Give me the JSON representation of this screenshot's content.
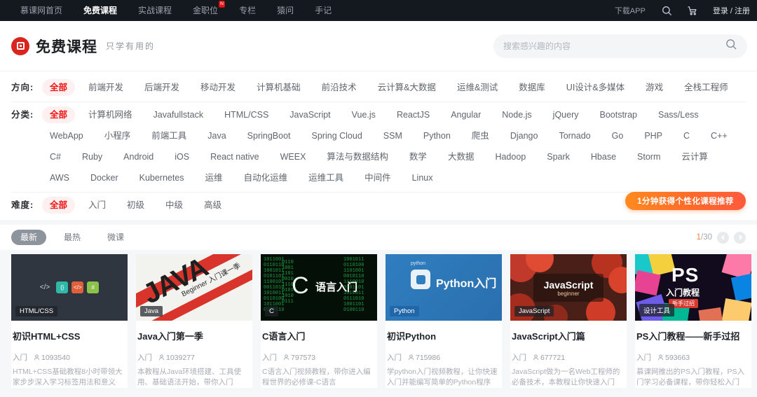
{
  "topnav": {
    "items": [
      {
        "label": "慕课网首页",
        "active": false,
        "badge": ""
      },
      {
        "label": "免费课程",
        "active": true,
        "badge": ""
      },
      {
        "label": "实战课程",
        "active": false,
        "badge": ""
      },
      {
        "label": "金职位",
        "active": false,
        "badge": "N"
      },
      {
        "label": "专栏",
        "active": false,
        "badge": ""
      },
      {
        "label": "猿问",
        "active": false,
        "badge": ""
      },
      {
        "label": "手记",
        "active": false,
        "badge": ""
      }
    ],
    "download_app": "下载APP",
    "search_icon": "search-icon",
    "cart_icon": "cart-icon",
    "login": "登录 / 注册"
  },
  "header": {
    "logo_icon": "imooc-logo-icon",
    "title": "免费课程",
    "subtitle": "只学有用的",
    "search": {
      "placeholder": "搜索感兴趣的内容",
      "value": "",
      "icon": "search-icon"
    }
  },
  "filters": {
    "accent_color": "#f01414",
    "groups": [
      {
        "label": "方向:",
        "items": [
          "全部",
          "前端开发",
          "后端开发",
          "移动开发",
          "计算机基础",
          "前沿技术",
          "云计算&大数据",
          "运维&测试",
          "数据库",
          "UI设计&多媒体",
          "游戏",
          "全栈工程师"
        ],
        "active": 0
      },
      {
        "label": "分类:",
        "items": [
          "全部",
          "计算机网络",
          "Javafullstack",
          "HTML/CSS",
          "JavaScript",
          "Vue.js",
          "ReactJS",
          "Angular",
          "Node.js",
          "jQuery",
          "Bootstrap",
          "Sass/Less",
          "WebApp",
          "小程序",
          "前端工具",
          "Java",
          "SpringBoot",
          "Spring Cloud",
          "SSM",
          "Python",
          "爬虫",
          "Django",
          "Tornado",
          "Go",
          "PHP",
          "C",
          "C++",
          "C#",
          "Ruby",
          "Android",
          "iOS",
          "React native",
          "WEEX",
          "算法与数据结构",
          "数学",
          "大数据",
          "Hadoop",
          "Spark",
          "Hbase",
          "Storm",
          "云计算",
          "AWS",
          "Docker",
          "Kubernetes",
          "运维",
          "自动化运维",
          "运维工具",
          "中间件",
          "Linux"
        ],
        "active": 0
      },
      {
        "label": "难度:",
        "items": [
          "全部",
          "入门",
          "初级",
          "中级",
          "高级"
        ],
        "active": 0
      }
    ],
    "reco_button": "1分钟获得个性化课程推荐"
  },
  "sortbar": {
    "tabs": [
      {
        "label": "最新",
        "active": true
      },
      {
        "label": "最热",
        "active": false
      },
      {
        "label": "微课",
        "active": false
      }
    ],
    "page_current": "1",
    "page_total": "/30",
    "prev_icon": "chevron-left-icon",
    "next_icon": "chevron-right-icon"
  },
  "cards": [
    {
      "thumb_tag": "HTML/CSS",
      "title": "初识HTML+CSS",
      "level": "入门",
      "learners": "1093540",
      "desc": "HTML+CSS基础教程8小时带领大家步步深入学习标签用法和意义",
      "learner_icon": "person-icon"
    },
    {
      "thumb_tag": "Java",
      "title": "Java入门第一季",
      "level": "入门",
      "learners": "1039277",
      "desc": "本教程从Java环境搭建、工具使用、基础语法开始，带你入门",
      "learner_icon": "person-icon",
      "thumb_text_big": "JAVA",
      "thumb_text_small": "Beginner 入门课一季",
      "thumb_text_cn": "入门课一季"
    },
    {
      "thumb_tag": "C",
      "title": "C语言入门",
      "level": "入门",
      "learners": "797573",
      "desc": "C语言入门视频教程，带你进入编程世界的必修课-C语言",
      "learner_icon": "person-icon",
      "thumb_text_cn": "语言入门"
    },
    {
      "thumb_tag": "Python",
      "title": "初识Python",
      "level": "入门",
      "learners": "715986",
      "desc": "学python入门视频教程，让你快速入门并能编写简单的Python程序",
      "learner_icon": "person-icon",
      "thumb_text_big": "Python入门",
      "thumb_text_small": "python"
    },
    {
      "thumb_tag": "JavaScript",
      "title": "JavaScript入门篇",
      "level": "入门",
      "learners": "677721",
      "desc": "JavaScript做为一名Web工程师的必备技术，本教程让你快速入门",
      "learner_icon": "person-icon",
      "thumb_text_big": "JavaScript",
      "thumb_text_small": "beginner"
    },
    {
      "thumb_tag": "设计工具",
      "title": "PS入门教程——新手过招",
      "level": "入门",
      "learners": "593663",
      "desc": "慕课网推出的PS入门教程，PS入门学习必备课程，带你轻松入门",
      "learner_icon": "person-icon",
      "thumb_text_big": "PS",
      "thumb_text_cn": "入门教程",
      "thumb_text_small": "新手过招"
    }
  ]
}
